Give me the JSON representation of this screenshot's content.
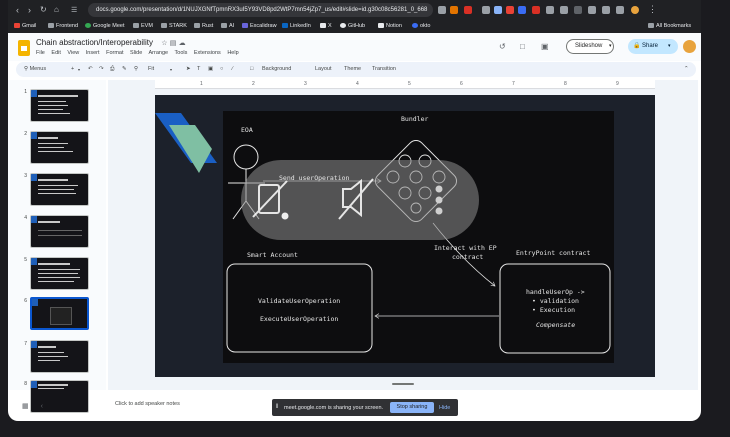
{
  "browser": {
    "url": "docs.google.com/presentation/d/1NUJXGNfTpmnRX3uI5Y93VD8pd2WtP7mn54jZp7_us/edit#slide=id.g30c08c56281_0_668",
    "bookmarks": [
      "Gmail",
      "Frontend",
      "Google Meet",
      "EVM",
      "STARK",
      "Rust",
      "AI",
      "Excalidraw",
      "LinkedIn",
      "X",
      "GitHub",
      "Notion",
      "okto"
    ],
    "all_bookmarks": "All Bookmarks"
  },
  "doc": {
    "title": "Chain abstraction/Interoperability",
    "menus": [
      "File",
      "Edit",
      "View",
      "Insert",
      "Format",
      "Slide",
      "Arrange",
      "Tools",
      "Extensions",
      "Help"
    ],
    "slideshow_label": "Slideshow",
    "share_label": "Share"
  },
  "toolbar": {
    "menus_label": "Menus",
    "fit_label": "Fit",
    "background_label": "Background",
    "layout_label": "Layout",
    "theme_label": "Theme",
    "transition_label": "Transition"
  },
  "ruler": [
    "1",
    "2",
    "3",
    "4",
    "5",
    "6",
    "7",
    "8",
    "9"
  ],
  "thumbnails": [
    "1",
    "2",
    "3",
    "4",
    "5",
    "6",
    "7",
    "8"
  ],
  "selected_slide": 6,
  "diagram": {
    "eoa": "EOA",
    "bundler": "Bundler",
    "send_op": "Send userOperation",
    "interact_line1": "Interact with EP",
    "interact_line2": "contract",
    "smart_account": "Smart Account",
    "entrypoint": "EntryPoint contract",
    "validate": "ValidateUserOperation",
    "execute": "ExecuteUserOperation",
    "handle": "handleUserOp ->",
    "validation": "• validation",
    "execution": "• Execution",
    "compensate": "Compensate"
  },
  "notes_placeholder": "Click to add speaker notes",
  "screen_share": {
    "text": "meet.google.com is sharing your screen.",
    "stop_label": "Stop sharing",
    "hide_label": "Hide"
  },
  "colors": {
    "accent_blue": "#0b57d0",
    "share_blue": "#c2e7ff",
    "board": "#0d0d0f",
    "slide_bg": "#1c212b"
  }
}
